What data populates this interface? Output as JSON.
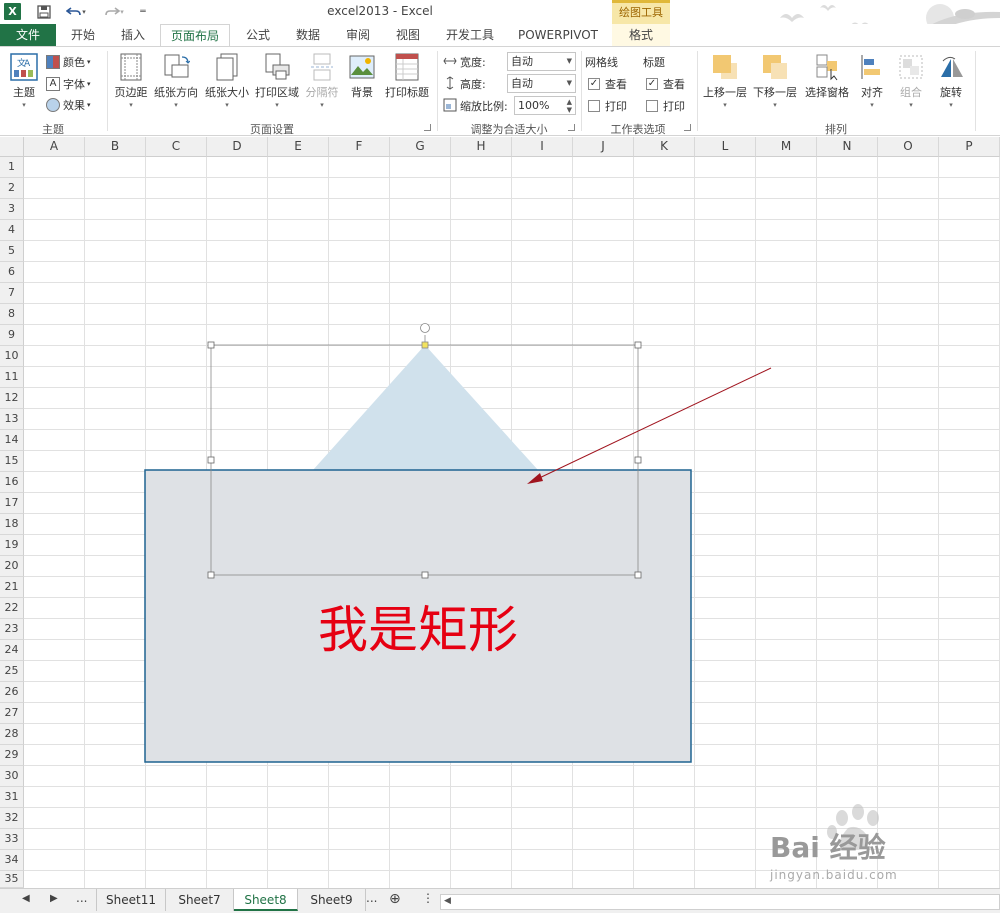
{
  "window": {
    "title": "excel2013 - Excel",
    "context_label": "绘图工具"
  },
  "tabs": [
    "文件",
    "开始",
    "插入",
    "页面布局",
    "公式",
    "数据",
    "审阅",
    "视图",
    "开发工具",
    "POWERPIVOT",
    "格式"
  ],
  "ribbon": {
    "theme_group": {
      "label": "主题",
      "theme_button": "主题",
      "colors": "颜色",
      "fonts": "字体",
      "effects": "效果"
    },
    "page_setup_group": {
      "label": "页面设置",
      "buttons": [
        "页边距",
        "纸张方向",
        "纸张大小",
        "打印区域",
        "分隔符",
        "背景",
        "打印标题"
      ]
    },
    "scale_group": {
      "label": "调整为合适大小",
      "width_label": "宽度:",
      "width_value": "自动",
      "height_label": "高度:",
      "height_value": "自动",
      "scale_label": "缩放比例:",
      "scale_value": "100%"
    },
    "sheet_options_group": {
      "label": "工作表选项",
      "gridlines_label": "网格线",
      "headings_label": "标题",
      "view_label": "查看",
      "print_label": "打印",
      "gridlines_view_checked": true,
      "gridlines_print_checked": false,
      "headings_view_checked": true,
      "headings_print_checked": false
    },
    "arrange_group": {
      "label": "排列",
      "buttons": [
        "上移一层",
        "下移一层",
        "选择窗格",
        "对齐",
        "组合",
        "旋转"
      ]
    }
  },
  "columns": [
    "A",
    "B",
    "C",
    "D",
    "E",
    "F",
    "G",
    "H",
    "I",
    "J",
    "K",
    "L",
    "M",
    "N",
    "O",
    "P"
  ],
  "rows": [
    "1",
    "2",
    "3",
    "4",
    "5",
    "6",
    "7",
    "8",
    "9",
    "10",
    "11",
    "12",
    "13",
    "14",
    "15",
    "16",
    "17",
    "18",
    "19",
    "20",
    "21",
    "22",
    "23",
    "24",
    "25",
    "26",
    "27",
    "28",
    "29",
    "30",
    "31",
    "32",
    "33",
    "34",
    "35"
  ],
  "shapes": {
    "rectangle_text": "我是矩形",
    "rectangle_fill": "#dee1e5",
    "rectangle_border": "#1f6391",
    "triangle_fill": "#d0e1ec",
    "arrow_color": "#a0141e",
    "text_color": "#e60012"
  },
  "sheets": {
    "tabs": [
      "Sheet11",
      "Sheet7",
      "Sheet8",
      "Sheet9"
    ],
    "active": "Sheet8",
    "overflow": "...",
    "more": "..."
  },
  "watermark": {
    "brand": "Bai 经验",
    "url": "jingyan.baidu.com"
  },
  "colors": {
    "excel_green": "#217346",
    "ribbon_bg": "#ffffff",
    "header_bg": "#f0f0f0"
  }
}
